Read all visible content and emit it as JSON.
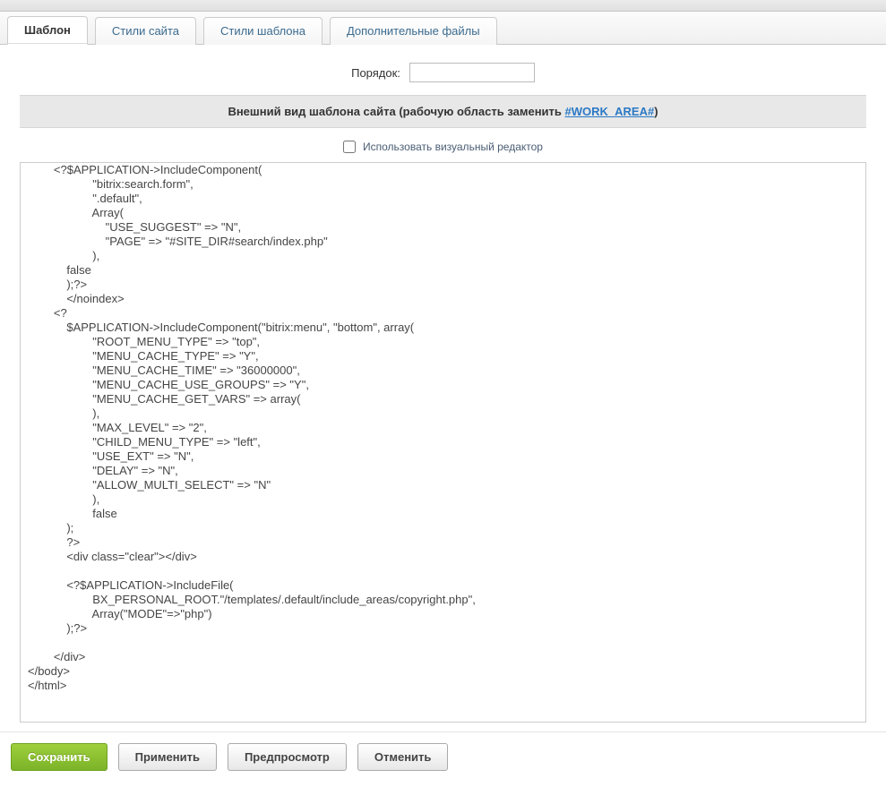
{
  "tabs": [
    {
      "label": "Шаблон",
      "active": true
    },
    {
      "label": "Стили сайта",
      "active": false
    },
    {
      "label": "Стили шаблона",
      "active": false
    },
    {
      "label": "Дополнительные файлы",
      "active": false
    }
  ],
  "order": {
    "label": "Порядок:",
    "value": ""
  },
  "section_header": {
    "text": "Внешний вид шаблона сайта (рабочую область заменить ",
    "link": "#WORK_AREA#",
    "suffix": ")"
  },
  "visual_editor_checkbox": {
    "label": "Использовать визуальный редактор",
    "checked": false
  },
  "code": "        <?$APPLICATION->IncludeComponent(\n                    \"bitrix:search.form\",\n                    \".default\",\n                    Array(\n                        \"USE_SUGGEST\" => \"N\",\n                        \"PAGE\" => \"#SITE_DIR#search/index.php\"\n                    ),\n            false\n            );?>\n            </noindex>\n        <?\n            $APPLICATION->IncludeComponent(\"bitrix:menu\", \"bottom\", array(\n                    \"ROOT_MENU_TYPE\" => \"top\",\n                    \"MENU_CACHE_TYPE\" => \"Y\",\n                    \"MENU_CACHE_TIME\" => \"36000000\",\n                    \"MENU_CACHE_USE_GROUPS\" => \"Y\",\n                    \"MENU_CACHE_GET_VARS\" => array(\n                    ),\n                    \"MAX_LEVEL\" => \"2\",\n                    \"CHILD_MENU_TYPE\" => \"left\",\n                    \"USE_EXT\" => \"N\",\n                    \"DELAY\" => \"N\",\n                    \"ALLOW_MULTI_SELECT\" => \"N\"\n                    ),\n                    false\n            );\n            ?>\n            <div class=\"clear\"></div>\n\n            <?$APPLICATION->IncludeFile(\n                    BX_PERSONAL_ROOT.\"/templates/.default/include_areas/copyright.php\",\n                    Array(\"MODE\"=>\"php\")\n            );?>\n\n        </div>\n</body>\n</html>",
  "buttons": {
    "save": "Сохранить",
    "apply": "Применить",
    "preview": "Предпросмотр",
    "cancel": "Отменить"
  }
}
